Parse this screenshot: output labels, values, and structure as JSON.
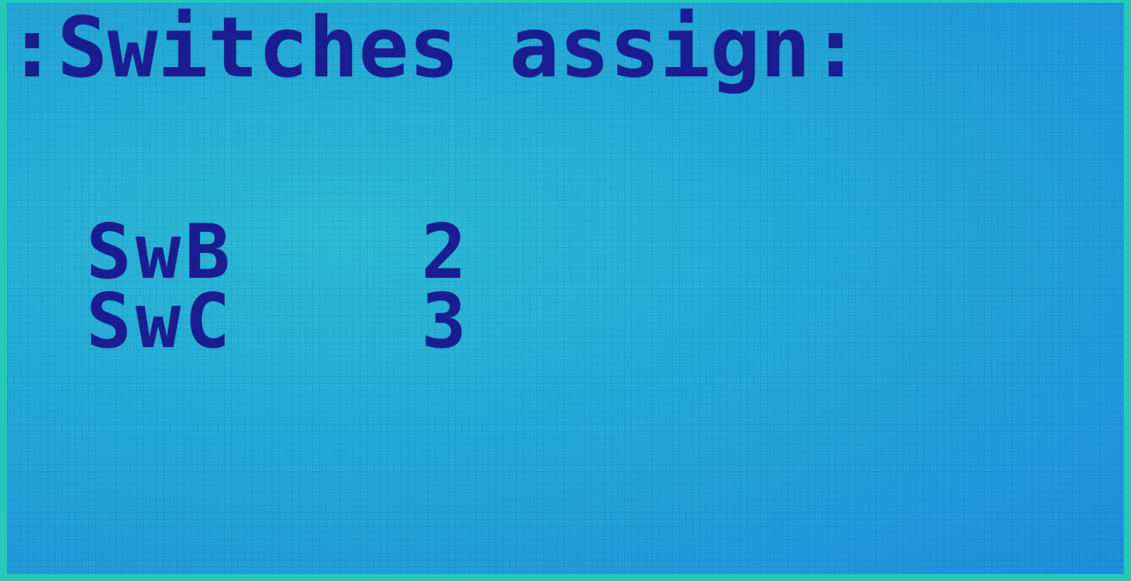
{
  "screen": {
    "title": ":Switches assign:",
    "background_color": "#24a9d6",
    "text_color": "#1a1d8f"
  },
  "assignments": [
    {
      "switch": "SwB",
      "value": "2"
    },
    {
      "switch": "SwC",
      "value": "3"
    }
  ]
}
